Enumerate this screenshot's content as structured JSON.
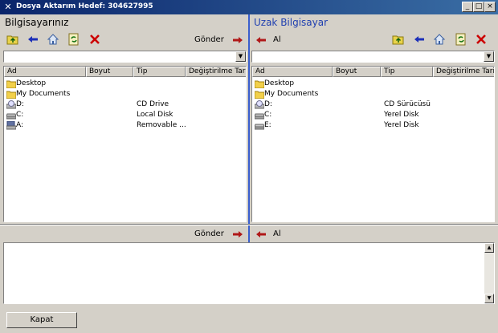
{
  "window": {
    "title": "Dosya Aktarım Hedef: 304627995",
    "min_label": "_",
    "max_label": "□",
    "close_label": "×"
  },
  "local": {
    "title": "Bilgisayarınız",
    "send_label": "Gönder",
    "columns": [
      "Ad",
      "Boyut",
      "Tip",
      "Değiştirilme Tarihi"
    ],
    "rows": [
      {
        "name": "Desktop",
        "type": "",
        "icon": "folder-icon"
      },
      {
        "name": "My Documents",
        "type": "",
        "icon": "folder-icon"
      },
      {
        "name": "D:",
        "type": "CD Drive",
        "icon": "cd-drive-icon"
      },
      {
        "name": "C:",
        "type": "Local Disk",
        "icon": "hard-disk-icon"
      },
      {
        "name": "A:",
        "type": "Removable ...",
        "icon": "floppy-drive-icon"
      }
    ]
  },
  "remote": {
    "title": "Uzak Bilgisayar",
    "receive_label": "Al",
    "columns": [
      "Ad",
      "Boyut",
      "Tip",
      "Değiştirilme Tarihi"
    ],
    "rows": [
      {
        "name": "Desktop",
        "type": "",
        "icon": "folder-icon"
      },
      {
        "name": "My Documents",
        "type": "",
        "icon": "folder-icon"
      },
      {
        "name": "D:",
        "type": "CD Sürücüsü",
        "icon": "cd-drive-icon"
      },
      {
        "name": "C:",
        "type": "Yerel Disk",
        "icon": "hard-disk-icon"
      },
      {
        "name": "E:",
        "type": "Yerel Disk",
        "icon": "hard-disk-icon"
      }
    ]
  },
  "transfer": {
    "send_label": "Gönder",
    "receive_label": "Al"
  },
  "footer": {
    "close_label": "Kapat"
  },
  "colors": {
    "title_bar": "#0a246a",
    "remote_title": "#1f3fb0",
    "arrow_red": "#b01818",
    "arrow_blue": "#1c2fb8",
    "delete_red": "#cc0000"
  }
}
